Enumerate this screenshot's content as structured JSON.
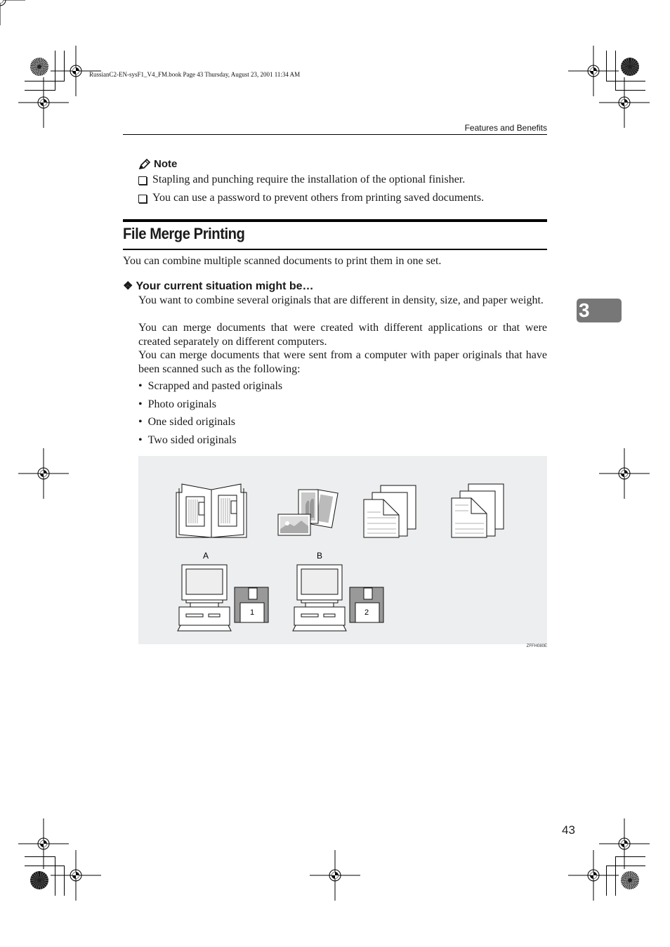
{
  "file_info": "RussianC2-EN-sysF1_V4_FM.book  Page 43  Thursday, August 23, 2001  11:34 AM",
  "running_head": "Features and Benefits",
  "note": {
    "icon": "pencil-icon",
    "title": "Note",
    "items": [
      "Stapling and punching require the installation of the optional finisher.",
      "You can use a password to prevent others from printing saved documents."
    ]
  },
  "section": {
    "title": "File Merge Printing",
    "intro": "You can combine multiple scanned documents to print them in one set.",
    "subsection": {
      "icon": "diamond-bullet-icon",
      "title": "Your current situation might be…",
      "paragraphs": [
        "You want to combine several originals that are different in density, size, and paper weight.",
        "You can merge documents that were created with different applications or that were created separately on different computers.",
        "You can merge documents that were sent from a computer with paper originals that have been scanned such as the following:"
      ],
      "list": [
        "Scrapped and pasted originals",
        "Photo originals",
        "One sided originals",
        "Two sided originals"
      ]
    }
  },
  "figure": {
    "labels": [
      "A",
      "B"
    ],
    "disk_numbers": [
      "1",
      "2"
    ],
    "code": "ZFFH080E"
  },
  "chapter_tab": "3",
  "page_number": "43"
}
